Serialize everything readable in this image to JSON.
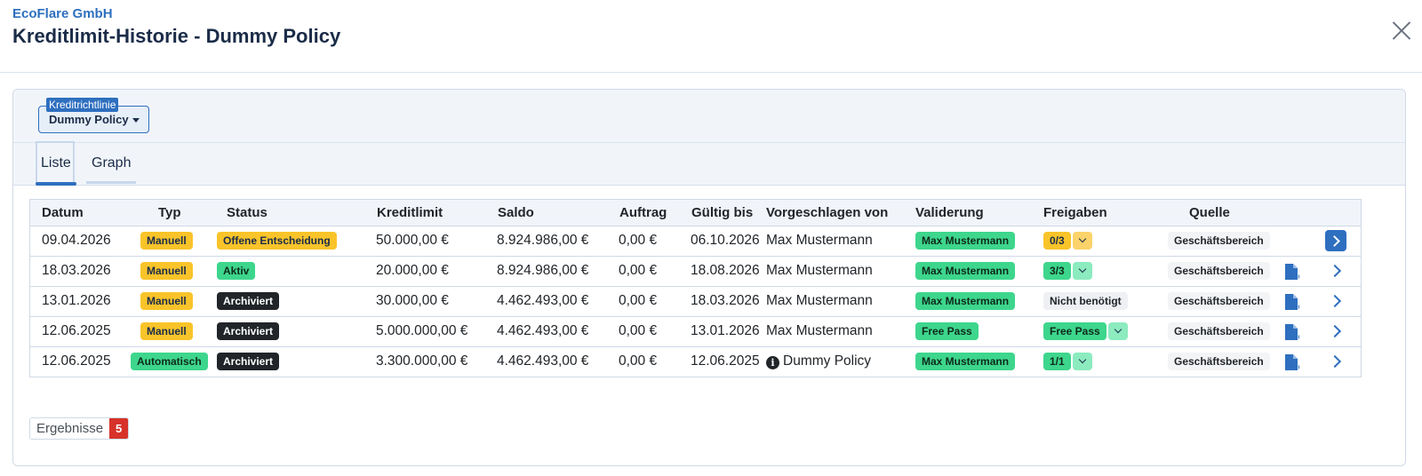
{
  "header": {
    "company": "EcoFlare GmbH",
    "title": "Kreditlimit-Historie - Dummy Policy"
  },
  "policy": {
    "label": "Kreditrichtlinie",
    "value": "Dummy Policy"
  },
  "tabs": [
    {
      "label": "Liste",
      "active": true
    },
    {
      "label": "Graph",
      "active": false
    }
  ],
  "table": {
    "columns": [
      "Datum",
      "Typ",
      "Status",
      "Kreditlimit",
      "Saldo",
      "Auftrag",
      "Gültig bis",
      "Vorgeschlagen von",
      "Validerung",
      "Freigaben",
      "Quelle"
    ],
    "rows": [
      {
        "datum": "09.04.2026",
        "typ": "Manuell",
        "status": "Offene Entscheidung",
        "kreditlimit": "50.000,00 €",
        "saldo": "8.924.986,00 €",
        "auftrag": "0,00 €",
        "gueltig": "06.10.2026",
        "vorgeschlagen": "Max Mustermann",
        "validerung": "Max Mustermann",
        "freigaben": "0/3",
        "quelle": "Geschäftsbereich"
      },
      {
        "datum": "18.03.2026",
        "typ": "Manuell",
        "status": "Aktiv",
        "kreditlimit": "20.000,00 €",
        "saldo": "8.924.986,00 €",
        "auftrag": "0,00 €",
        "gueltig": "18.08.2026",
        "vorgeschlagen": "Max Mustermann",
        "validerung": "Max Mustermann",
        "freigaben": "3/3",
        "quelle": "Geschäftsbereich"
      },
      {
        "datum": "13.01.2026",
        "typ": "Manuell",
        "status": "Archiviert",
        "kreditlimit": "30.000,00 €",
        "saldo": "4.462.493,00 €",
        "auftrag": "0,00 €",
        "gueltig": "18.03.2026",
        "vorgeschlagen": "Max Mustermann",
        "validerung": "Max Mustermann",
        "freigaben": "Nicht benötigt",
        "quelle": "Geschäftsbereich"
      },
      {
        "datum": "12.06.2025",
        "typ": "Manuell",
        "status": "Archiviert",
        "kreditlimit": "5.000.000,00 €",
        "saldo": "4.462.493,00 €",
        "auftrag": "0,00 €",
        "gueltig": "13.01.2026",
        "vorgeschlagen": "Max Mustermann",
        "validerung": "Free Pass",
        "freigaben": "Free Pass",
        "quelle": "Geschäftsbereich"
      },
      {
        "datum": "12.06.2025",
        "typ": "Automatisch",
        "status": "Archiviert",
        "kreditlimit": "3.300.000,00 €",
        "saldo": "4.462.493,00 €",
        "auftrag": "0,00 €",
        "gueltig": "12.06.2025",
        "vorgeschlagen": "Dummy Policy",
        "validerung": "Max Mustermann",
        "freigaben": "1/1",
        "quelle": "Geschäftsbereich"
      }
    ]
  },
  "results": {
    "label": "Ergebnisse",
    "count": "5"
  },
  "colors": {
    "accent": "#2e6fbf",
    "manual": "#f9c42a",
    "green": "#3dd68c",
    "archived": "#212529",
    "count_badge": "#d6322a"
  }
}
